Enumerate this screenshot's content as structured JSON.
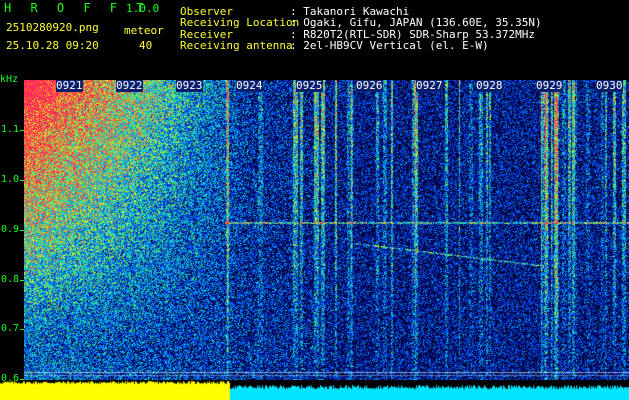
{
  "app": {
    "name": "H R O F F T",
    "version": "1.0.0",
    "filename": "2510280920.png",
    "datetime": "25.10.28 09:20",
    "meteor_label": "meteor",
    "meteor_count": "40"
  },
  "info": {
    "observer_label": "Observer",
    "observer_value": ": Takanori Kawachi",
    "location_label": "Receiving Location",
    "location_value": ": Ogaki, Gifu, JAPAN (136.60E, 35.35N)",
    "receiver_label": "Receiver",
    "receiver_value": ": R820T2(RTL-SDR) SDR-Sharp 53.372MHz",
    "antenna_label": "Receiving antenna",
    "antenna_value": ": 2el-HB9CV Vertical (el. E-W)"
  },
  "axis": {
    "unit": "kHz",
    "y_labels": [
      "1.1",
      "1.0",
      "0.9",
      "0.8",
      "0.7",
      "0.6"
    ],
    "time_labels": [
      "0921",
      "0922",
      "0923",
      "0924",
      "0925",
      "0926",
      "0927",
      "0928",
      "0929",
      "0930"
    ]
  },
  "colors": {
    "text_green": "#1aff1a",
    "text_yellow": "#ffff33",
    "footer_yellow": "#ffff00",
    "footer_cyan": "#00e5ff"
  }
}
